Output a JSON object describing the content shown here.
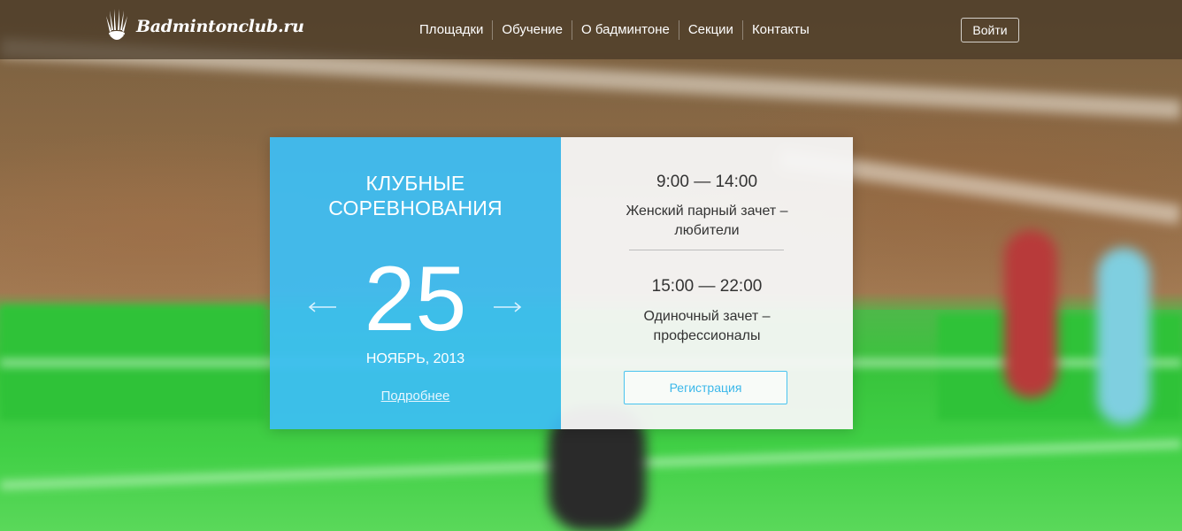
{
  "header": {
    "logo_text": "Badmintonclub.ru",
    "nav": [
      {
        "label": "Площадки"
      },
      {
        "label": "Обучение"
      },
      {
        "label": "О бадминтоне"
      },
      {
        "label": "Секции"
      },
      {
        "label": "Контакты"
      }
    ],
    "login_label": "Войти"
  },
  "event": {
    "title_line1": "КЛУБНЫЕ",
    "title_line2": "СОРЕВНОВАНИЯ",
    "day": "25",
    "month_year": "НОЯБРЬ, 2013",
    "more_link": "Подробнее",
    "prev_icon": "arrow-left-icon",
    "next_icon": "arrow-right-icon"
  },
  "schedule": [
    {
      "time": "9:00 — 14:00",
      "desc_line1": "Женский парный зачет –",
      "desc_line2": "любители"
    },
    {
      "time": "15:00 — 22:00",
      "desc_line1": "Одиночный зачет –",
      "desc_line2": "профессионалы"
    }
  ],
  "register_label": "Регистрация",
  "colors": {
    "accent_blue": "#3cbef5",
    "register_text": "#3cb8ea",
    "header_bg": "#463826"
  }
}
